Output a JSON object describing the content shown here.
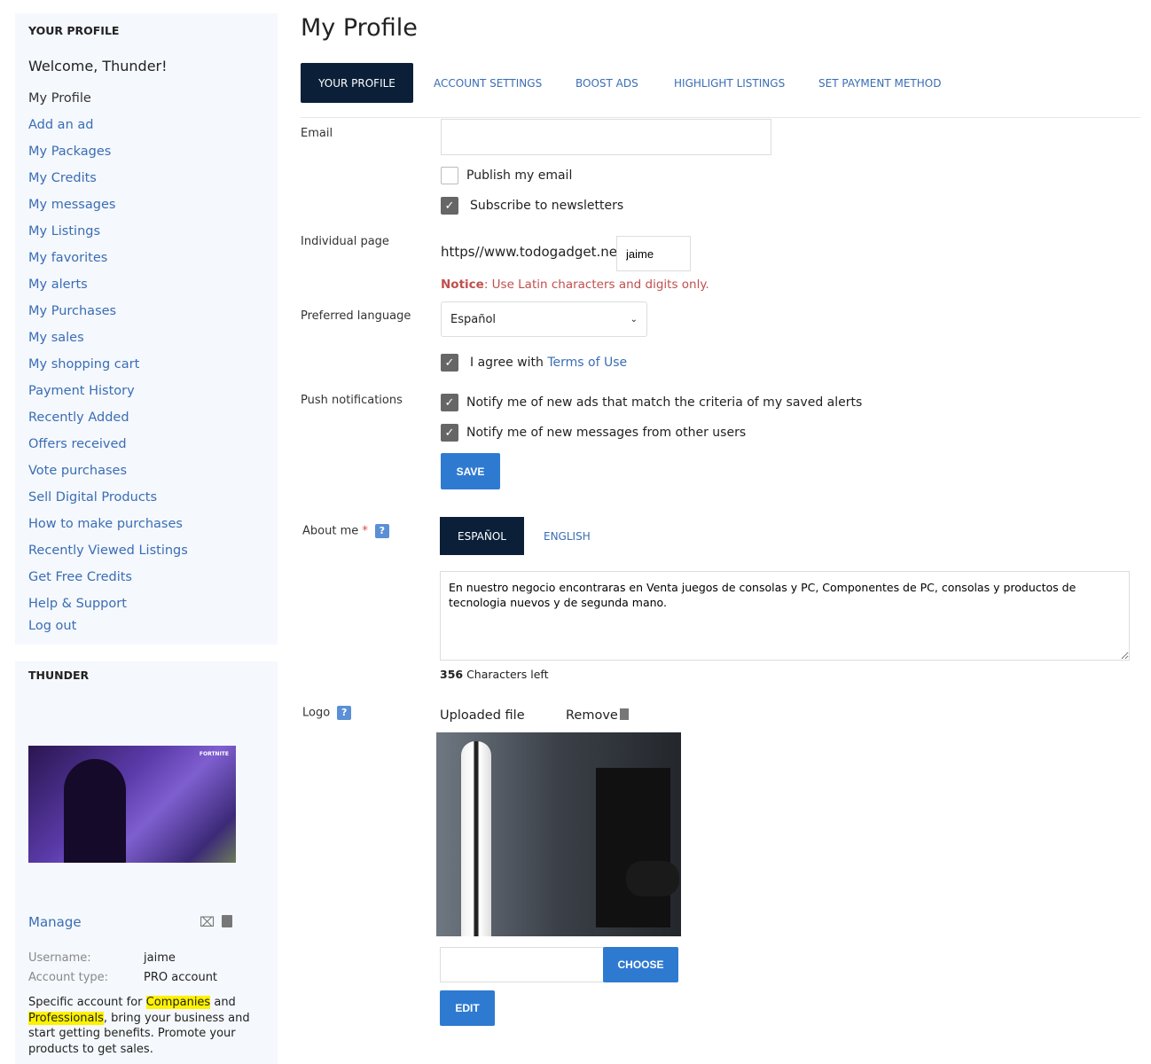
{
  "sidebar": {
    "title": "YOUR PROFILE",
    "welcome": "Welcome, Thunder!",
    "items": [
      "My Profile",
      "Add an ad",
      "My Packages",
      "My Credits",
      "My messages",
      "My Listings",
      "My favorites",
      "My alerts",
      "My Purchases",
      "My sales",
      "My shopping cart",
      "Payment History",
      "Recently Added",
      "Offers received",
      "Vote purchases",
      "Sell Digital Products",
      "How to make purchases",
      "Recently Viewed Listings",
      "Get Free Credits",
      "Help & Support",
      "Log out"
    ]
  },
  "account": {
    "title": "THUNDER",
    "manage": "Manage",
    "username_label": "Username:",
    "username": "jaime",
    "type_label": "Account type:",
    "type": "PRO account",
    "desc_1": "Specific account for ",
    "desc_companies": "Companies",
    "desc_2": " and ",
    "desc_professionals": "Professionals",
    "desc_3": ", bring your business and start getting benefits. Promote your products to get sales.",
    "avatar_text": "FORTNITE"
  },
  "main": {
    "title": "My Profile",
    "tabs": [
      "YOUR PROFILE",
      "ACCOUNT SETTINGS",
      "BOOST ADS",
      "HIGHLIGHT LISTINGS",
      "SET PAYMENT METHOD"
    ],
    "email_label": "Email",
    "email_value": "",
    "publish_email": "Publish my email",
    "publish_checked": false,
    "subscribe": "Subscribe to newsletters",
    "subscribe_checked": true,
    "page_label": "Individual page",
    "page_prefix": "https//www.todogadget.net/",
    "page_value": "jaime",
    "notice_label": "Notice",
    "notice_text": ": Use Latin characters and digits only.",
    "lang_label": "Preferred language",
    "lang_value": "Español",
    "agree_1": "I agree with ",
    "agree_link": "Terms of Use",
    "agree_checked": true,
    "push_label": "Push notifications",
    "push_1": "Notify me of new ads that match the criteria of my saved alerts",
    "push_2": "Notify me of new messages from other users",
    "save": "SAVE",
    "about_label": "About me",
    "required": "*",
    "help": "?",
    "about_tabs": [
      "ESPAÑOL",
      "ENGLISH"
    ],
    "about_text": "En nuestro negocio encontraras en Venta juegos de consolas y PC, Componentes de PC, consolas y productos de tecnologia nuevos y de segunda mano.",
    "chars_count": "356",
    "chars_left": " Characters left",
    "logo_label": "Logo",
    "uploaded": "Uploaded file",
    "remove": "Remove",
    "choose": "CHOOSE",
    "edit": "EDIT",
    "colors": {
      "accent": "#2f7ad1",
      "dark_tab": "#0b2038",
      "link": "#3a6db5",
      "notice": "#c0504d",
      "highlight": "#fff200"
    }
  }
}
